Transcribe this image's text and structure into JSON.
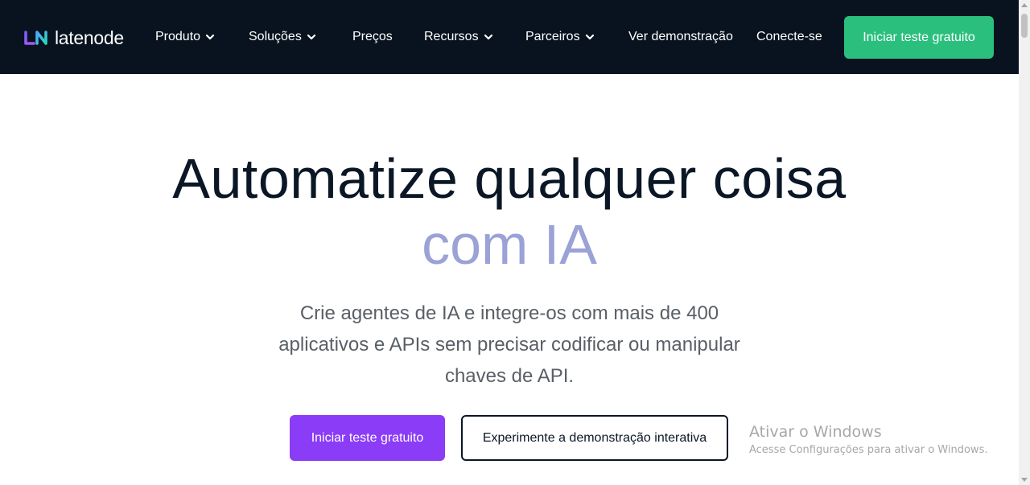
{
  "brand": {
    "name": "latenode",
    "logo_icon": "latenode-logo-icon",
    "colors": {
      "nav_bg": "#08131f",
      "accent_green": "#2bbf7e",
      "accent_purple": "#8b3cf7",
      "headline_dark": "#0b1726",
      "headline_accent": "#9aa2d6"
    }
  },
  "nav": {
    "items": [
      {
        "label": "Produto",
        "has_dropdown": true,
        "icon": "chevron-down-icon"
      },
      {
        "label": "Soluções",
        "has_dropdown": true,
        "icon": "chevron-down-icon"
      },
      {
        "label": "Preços",
        "has_dropdown": false
      },
      {
        "label": "Recursos",
        "has_dropdown": true,
        "icon": "chevron-down-icon"
      },
      {
        "label": "Parceiros",
        "has_dropdown": true,
        "icon": "chevron-down-icon"
      },
      {
        "label": "Ver demonstração",
        "has_dropdown": false
      },
      {
        "label": "Conecte-se",
        "has_dropdown": false
      }
    ],
    "cta_label": "Iniciar teste gratuito"
  },
  "hero": {
    "headline_line1": "Automatize qualquer coisa",
    "headline_line2": "com IA",
    "subtitle": "Crie agentes de IA e integre-os com mais de 400 aplicativos e APIs sem precisar codificar ou manipular chaves de API.",
    "primary_button": "Iniciar teste gratuito",
    "secondary_button": "Experimente a demonstração interativa"
  },
  "os_watermark": {
    "title": "Ativar o Windows",
    "subtitle": "Acesse Configurações para ativar o Windows."
  }
}
